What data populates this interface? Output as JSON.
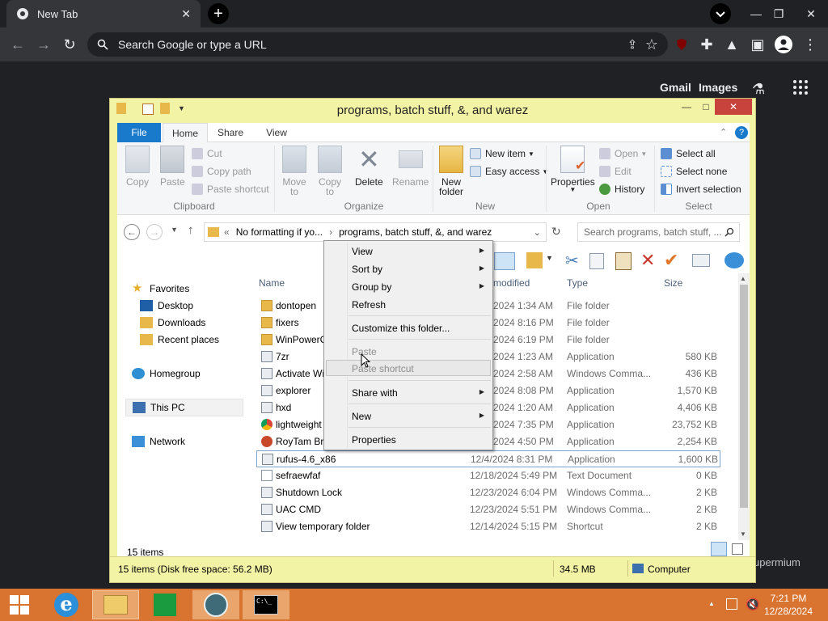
{
  "browser": {
    "tab_title": "New Tab",
    "tab_close": "✕",
    "new_tab": "+",
    "omnibox_placeholder": "Search Google or type a URL",
    "ntp_links": [
      "Gmail",
      "Images"
    ],
    "bottom_text": "upermium"
  },
  "explorer": {
    "title": "programs, batch stuff, &, and warez",
    "ribbon_tabs": [
      "File",
      "Home",
      "Share",
      "View"
    ],
    "clipboard": {
      "copy": "Copy",
      "paste": "Paste",
      "cut": "Cut",
      "copy_path": "Copy path",
      "paste_shortcut": "Paste shortcut",
      "label": "Clipboard"
    },
    "organize": {
      "move_to": "Move",
      "move_to2": "to",
      "copy_to": "Copy",
      "copy_to2": "to",
      "delete": "Delete",
      "rename": "Rename",
      "label": "Organize"
    },
    "new": {
      "new_folder": "New",
      "new_folder2": "folder",
      "new_item": "New item",
      "easy_access": "Easy access",
      "label": "New"
    },
    "open": {
      "properties": "Properties",
      "open": "Open",
      "edit": "Edit",
      "history": "History",
      "label": "Open"
    },
    "select": {
      "select_all": "Select all",
      "select_none": "Select none",
      "invert": "Invert selection",
      "label": "Select"
    },
    "address": {
      "prefix": "«",
      "crumb1": "No formatting if yo...",
      "sep": "›",
      "crumb2": "programs, batch stuff, &, and warez"
    },
    "search_placeholder": "Search programs, batch stuff, ...",
    "nav": {
      "favorites": "Favorites",
      "desktop": "Desktop",
      "downloads": "Downloads",
      "recent": "Recent places",
      "homegroup": "Homegroup",
      "thispc": "This PC",
      "network": "Network"
    },
    "columns": {
      "name": "Name",
      "date": "modified",
      "type": "Type",
      "size": "Size"
    },
    "files": [
      {
        "name": "dontopen",
        "date": "2024 1:34 AM",
        "type": "File folder",
        "size": "",
        "icon": "folder"
      },
      {
        "name": "fixers",
        "date": "2024 8:16 PM",
        "type": "File folder",
        "size": "",
        "icon": "folder"
      },
      {
        "name": "WinPowerC",
        "date": "2024 6:19 PM",
        "type": "File folder",
        "size": "",
        "icon": "folder"
      },
      {
        "name": "7zr",
        "date": "2024 1:23 AM",
        "type": "Application",
        "size": "580 KB",
        "icon": "app"
      },
      {
        "name": "Activate Wi",
        "date": "2024 2:58 AM",
        "type": "Windows Comma...",
        "size": "436 KB",
        "icon": "cmd"
      },
      {
        "name": "explorer",
        "date": "2024 8:08 PM",
        "type": "Application",
        "size": "1,570 KB",
        "icon": "app"
      },
      {
        "name": "hxd",
        "date": "2024 1:20 AM",
        "type": "Application",
        "size": "4,406 KB",
        "icon": "app"
      },
      {
        "name": "lightweight",
        "date": "2024 7:35 PM",
        "type": "Application",
        "size": "23,752 KB",
        "icon": "chrome"
      },
      {
        "name": "RoyTam Br",
        "date": "2024 4:50 PM",
        "type": "Application",
        "size": "2,254 KB",
        "icon": "firefox"
      },
      {
        "name": "rufus-4.6_x86",
        "date": "12/4/2024 8:31 PM",
        "type": "Application",
        "size": "1,600 KB",
        "icon": "app"
      },
      {
        "name": "sefraewfaf",
        "date": "12/18/2024 5:49 PM",
        "type": "Text Document",
        "size": "0 KB",
        "icon": "txt"
      },
      {
        "name": "Shutdown Lock",
        "date": "12/23/2024 6:04 PM",
        "type": "Windows Comma...",
        "size": "2 KB",
        "icon": "cmd"
      },
      {
        "name": "UAC CMD",
        "date": "12/23/2024 5:51 PM",
        "type": "Windows Comma...",
        "size": "2 KB",
        "icon": "cmd"
      },
      {
        "name": "View temporary folder",
        "date": "12/14/2024 5:15 PM",
        "type": "Shortcut",
        "size": "2 KB",
        "icon": "cmd"
      }
    ],
    "items_count": "15 items",
    "status_left": "15 items (Disk free space: 56.2 MB)",
    "status_size": "34.5 MB",
    "status_location": "Computer"
  },
  "context_menu": {
    "view": "View",
    "sort_by": "Sort by",
    "group_by": "Group by",
    "refresh": "Refresh",
    "customize": "Customize this folder...",
    "paste": "Paste",
    "paste_shortcut": "Paste shortcut",
    "share_with": "Share with",
    "new": "New",
    "properties": "Properties"
  },
  "taskbar": {
    "time": "7:21 PM",
    "date": "12/28/2024",
    "cmd_icon_text": "C:\\_"
  },
  "colors": {
    "explorer_frame": "#f3f3a6",
    "taskbar": "#d97330",
    "file_tab": "#1979ca",
    "close_button": "#c7433b"
  }
}
